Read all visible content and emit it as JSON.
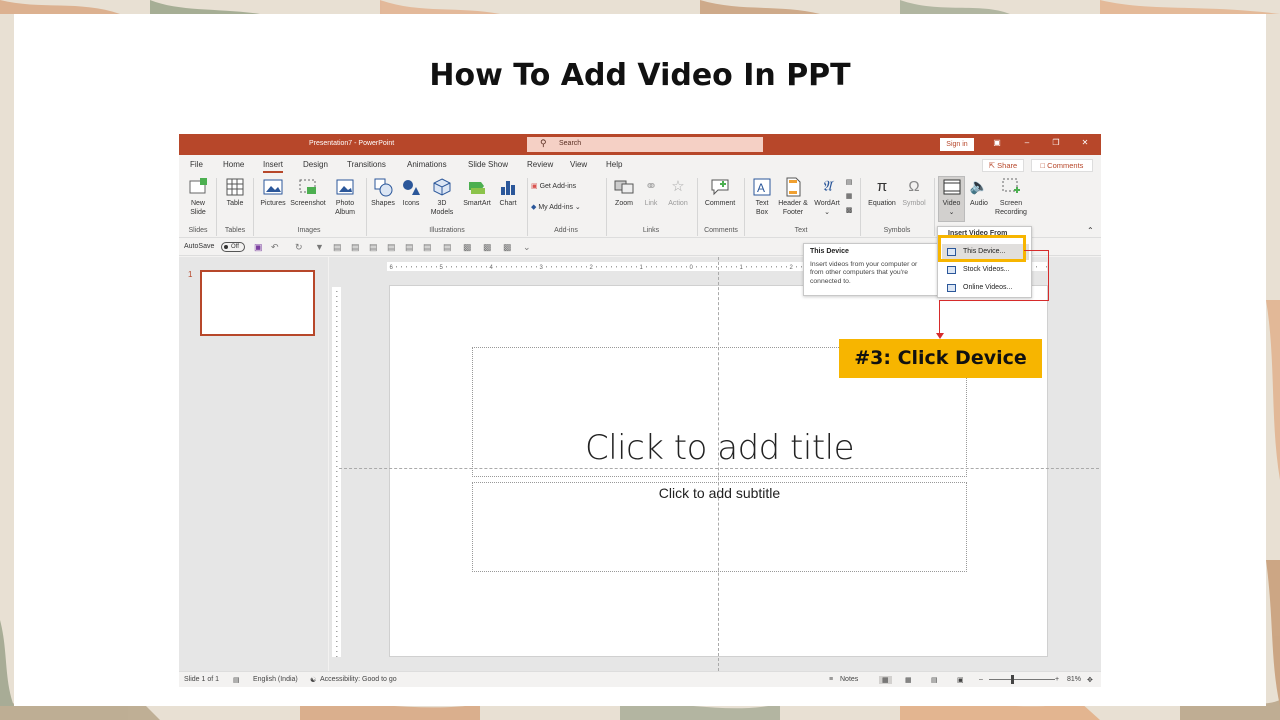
{
  "slide_heading": "How To Add Video In PPT",
  "app": {
    "doc_title": "Presentation7 - PowerPoint",
    "search_placeholder": "Search",
    "sign_in": "Sign in",
    "accent_color": "#b7472a"
  },
  "menu_tabs": [
    "File",
    "Home",
    "Insert",
    "Design",
    "Transitions",
    "Animations",
    "Slide Show",
    "Review",
    "View",
    "Help"
  ],
  "active_tab": "Insert",
  "share_label": "Share",
  "comments_label": "Comments",
  "ribbon": {
    "new_slide": "New Slide",
    "table": "Table",
    "pictures": "Pictures",
    "screenshot": "Screenshot",
    "photo_album": "Photo Album",
    "shapes": "Shapes",
    "icons": "Icons",
    "models_3d": "3D Models",
    "smartart": "SmartArt",
    "chart": "Chart",
    "get_addins": "Get Add-ins",
    "my_addins": "My Add-ins",
    "zoom": "Zoom",
    "link": "Link",
    "action": "Action",
    "comment": "Comment",
    "text_box": "Text Box",
    "header_footer": "Header & Footer",
    "wordart": "WordArt",
    "equation": "Equation",
    "symbol": "Symbol",
    "video": "Video",
    "audio": "Audio",
    "screen_recording": "Screen Recording"
  },
  "groups": {
    "slides": "Slides",
    "tables": "Tables",
    "images": "Images",
    "illustrations": "Illustrations",
    "addins": "Add-ins",
    "links": "Links",
    "comments": "Comments",
    "text": "Text",
    "symbols": "Symbols"
  },
  "qat": {
    "autosave": "AutoSave",
    "toggle": "Off"
  },
  "slide_number": "1",
  "placeholders": {
    "title": "Click to add title",
    "subtitle": "Click to add subtitle"
  },
  "tooltip": {
    "title": "This Device",
    "body": "Insert videos from your computer or from other computers that you're connected to."
  },
  "video_menu": {
    "header": "Insert Video From",
    "items": [
      "This Device...",
      "Stock Videos...",
      "Online Videos..."
    ]
  },
  "status": {
    "slide": "Slide 1 of 1",
    "language": "English (India)",
    "accessibility": "Accessibility: Good to go",
    "notes": "Notes",
    "zoom": "81%"
  },
  "callout": "#3: Click Device",
  "highlight_color": "#f7b500",
  "arrow_color": "#d62b2b"
}
